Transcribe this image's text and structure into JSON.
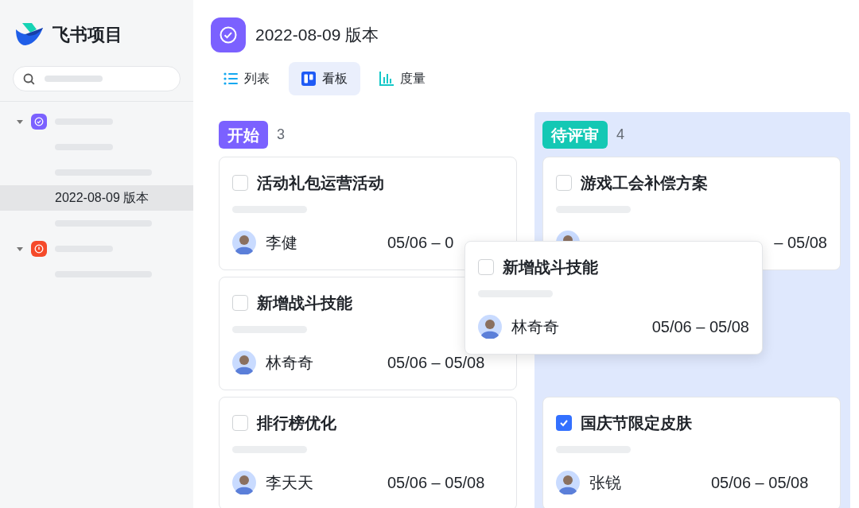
{
  "app": {
    "name": "飞书项目"
  },
  "sidebar": {
    "groups": [
      {
        "color": "#7b61ff",
        "kind": "check",
        "expanded": true,
        "items": [
          {
            "kind": "placeholder",
            "selected": false
          },
          {
            "kind": "placeholder-long",
            "selected": false
          },
          {
            "kind": "text",
            "label": "2022-08-09 版本",
            "selected": true
          },
          {
            "kind": "placeholder-long",
            "selected": false
          }
        ]
      },
      {
        "color": "#f54a2a",
        "kind": "alert",
        "expanded": true,
        "items": [
          {
            "kind": "placeholder-long",
            "selected": false
          }
        ]
      }
    ]
  },
  "header": {
    "title": "2022-08-09 版本"
  },
  "tabs": [
    {
      "label": "列表",
      "kind": "list",
      "selected": false
    },
    {
      "label": "看板",
      "kind": "board",
      "selected": true
    },
    {
      "label": "度量",
      "kind": "chart",
      "selected": false
    }
  ],
  "columns": [
    {
      "title": "开始",
      "count": "3",
      "color": "#7b61ff",
      "highlighted": false,
      "cards": [
        {
          "kind": "card",
          "title": "活动礼包运营活动",
          "checked": false,
          "assignee": "李健",
          "dates": "05/06 – 0"
        },
        {
          "kind": "card",
          "title": "新增战斗技能",
          "checked": false,
          "assignee": "林奇奇",
          "dates": "05/06 – 05/08"
        },
        {
          "kind": "card",
          "title": "排行榜优化",
          "checked": false,
          "assignee": "李天天",
          "dates": "05/06 – 05/08"
        }
      ]
    },
    {
      "title": "待评审",
      "count": "4",
      "color": "#14c8b4",
      "highlighted": true,
      "cards": [
        {
          "kind": "covered",
          "title": "游戏工会补偿方案",
          "checked": false,
          "dates": "– 05/08"
        },
        {
          "kind": "drop-slot"
        },
        {
          "kind": "card",
          "title": "国庆节限定皮肤",
          "checked": true,
          "assignee": "张锐",
          "dates": "05/06 – 05/08"
        }
      ]
    }
  ],
  "dragging_card": {
    "title": "新增战斗技能",
    "checked": false,
    "assignee": "林奇奇",
    "dates": "05/06 – 05/08"
  }
}
